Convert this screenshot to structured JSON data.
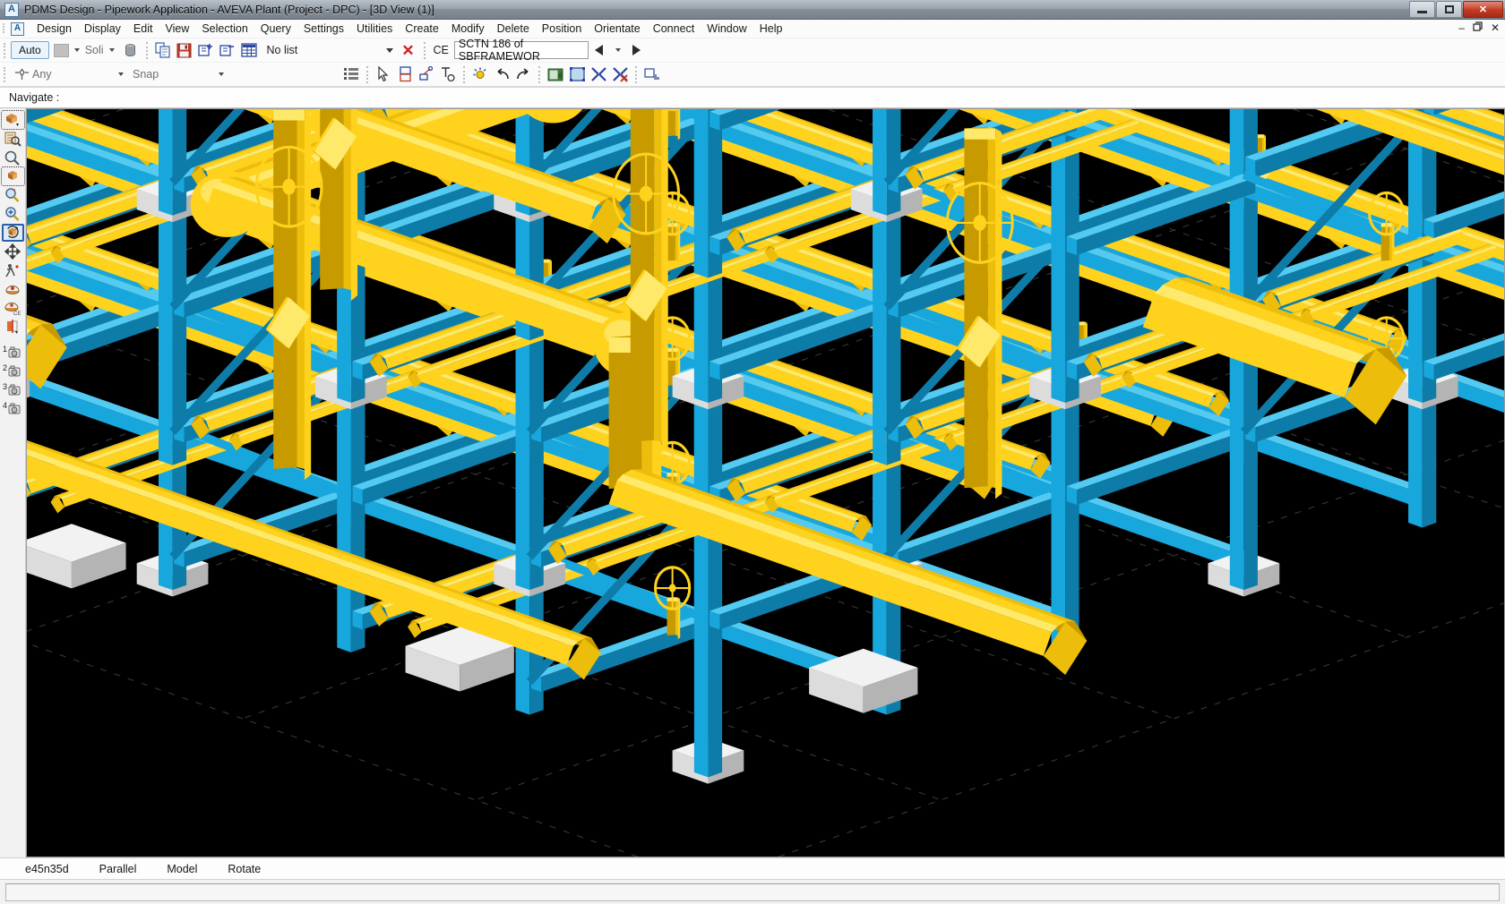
{
  "window": {
    "title": "PDMS Design - Pipework Application -  AVEVA Plant (Project - DPC) - [3D View (1)]",
    "app_badge": "A",
    "controls": {
      "minimize": "–",
      "restore": "❐",
      "close": "✕"
    },
    "mdi_controls": {
      "minimize": "–",
      "restore": "❐",
      "close": "✕"
    }
  },
  "menubar": {
    "badge": "A",
    "items": [
      {
        "label": "Design"
      },
      {
        "label": "Display"
      },
      {
        "label": "Edit"
      },
      {
        "label": "View"
      },
      {
        "label": "Selection"
      },
      {
        "label": "Query"
      },
      {
        "label": "Settings"
      },
      {
        "label": "Utilities"
      },
      {
        "label": "Create"
      },
      {
        "label": "Modify"
      },
      {
        "label": "Delete"
      },
      {
        "label": "Position"
      },
      {
        "label": "Orientate"
      },
      {
        "label": "Connect"
      },
      {
        "label": "Window"
      },
      {
        "label": "Help"
      }
    ]
  },
  "toolbar_main": {
    "auto_label": "Auto",
    "representation_value": "Soli",
    "delete_icon": "trash-icon",
    "copy_icon": "copy-to-file-icon",
    "save_icon": "save-icon",
    "add_to_list_icon": "add-to-list-icon",
    "remove_from_list_icon": "remove-from-list-icon",
    "list_grid_icon": "list-grid-icon",
    "list_value": "No list",
    "clear_label": "✕",
    "ce_label": "CE",
    "ce_value": "SCTN 186 of SBFRAMEWOR",
    "nav_back_icon": "arrow-left-icon",
    "nav_forward_icon": "arrow-right-icon"
  },
  "toolbar_secondary": {
    "pick_filter_icon": "pick-any-icon",
    "pick_filter_value": "Any",
    "snap_value": "Snap",
    "grid_icon": "grid-icon",
    "pointer_icon": "pointer-icon",
    "box_icon": "extrude-box-icon",
    "measure_icon": "measure-icon",
    "dimension_icon": "dimension-icon",
    "light_icon": "light-bulb-icon",
    "undo_icon": "undo-icon",
    "redo_icon": "redo-icon",
    "walk_icon": "walkthrough-icon",
    "limits_icon": "view-limits-icon",
    "clash_icon": "clash-check-icon",
    "clash_clear_icon": "clash-clear-icon",
    "graphics_icon": "graphics-settings-icon"
  },
  "navigate_bar": {
    "label": "Navigate :"
  },
  "side_toolbar": {
    "items": [
      {
        "name": "view-model-icon",
        "label": "Model view",
        "selected": false,
        "dashed": true
      },
      {
        "name": "look-query-icon",
        "label": "Look / query",
        "selected": false
      },
      {
        "name": "zoom-area-icon",
        "label": "Zoom to area",
        "selected": false
      },
      {
        "name": "limits-box-icon",
        "label": "View limits",
        "selected": false,
        "dashed": true
      },
      {
        "name": "zoom-select-icon",
        "label": "Zoom selection",
        "selected": false
      },
      {
        "name": "zoom-in-icon",
        "label": "Zoom in",
        "selected": false
      },
      {
        "name": "rotate-model-icon",
        "label": "Rotate model",
        "selected": true
      },
      {
        "name": "pan-icon",
        "label": "Pan",
        "selected": false
      },
      {
        "name": "walk-icon",
        "label": "Walk",
        "selected": false
      },
      {
        "name": "look-from-icon",
        "label": "Look from",
        "selected": false
      },
      {
        "name": "look-ce-icon",
        "label": "Look at CE",
        "selected": false
      },
      {
        "name": "clip-plane-icon",
        "label": "Clipping plane",
        "selected": false
      },
      {
        "name": "view-preset-1-icon",
        "label": "1",
        "selected": false
      },
      {
        "name": "view-preset-2-icon",
        "label": "2",
        "selected": false
      },
      {
        "name": "view-preset-3-icon",
        "label": "3",
        "selected": false
      },
      {
        "name": "view-preset-4-icon",
        "label": "4",
        "selected": false
      }
    ]
  },
  "view_status": {
    "view_direction": "e45n35d",
    "projection": "Parallel",
    "mode": "Model",
    "action": "Rotate"
  },
  "command_line": {
    "value": "",
    "placeholder": ""
  },
  "scene": {
    "background": "#000000",
    "pipe_color": "#FFD21E",
    "pipe_shade_dark": "#C79A00",
    "pipe_shade_mid": "#EDBD0B",
    "pipe_highlight": "#FFE96B",
    "steel_color": "#18A7DC",
    "steel_shade_dark": "#0E7CA8",
    "steel_highlight": "#53CAF2",
    "concrete_color": "#E8E8E8",
    "concrete_shade": "#BDBDBD",
    "green_color": "#3FA93F",
    "grid_line": "#3a3a3a",
    "description": "Isometric 3D model of a process plant: yellow piping runs with valves and handwheels on cyan structural steel racks, white concrete foundations, viewed from e45n35d parallel projection"
  }
}
